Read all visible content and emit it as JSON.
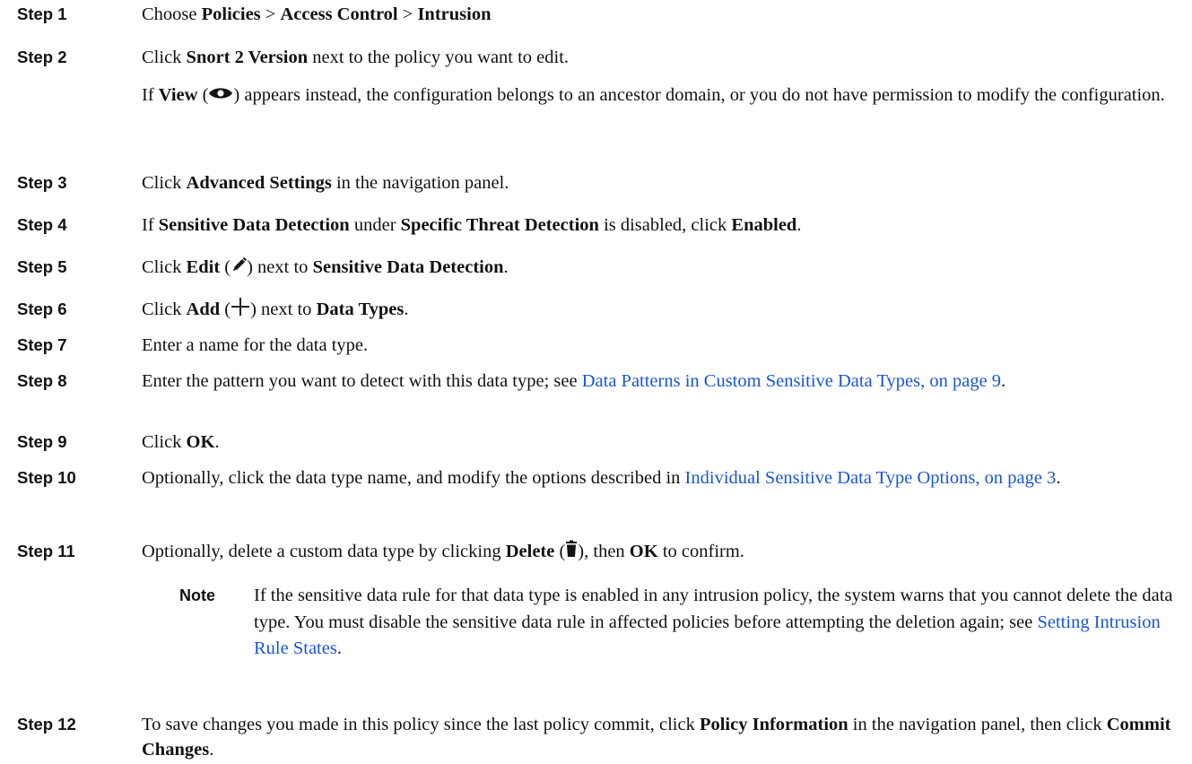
{
  "steps": [
    {
      "label": "Step 1",
      "t0": "Choose ",
      "b0": "Policies",
      "t1": " > ",
      "b1": "Access Control",
      "t2": " > ",
      "b2": "Intrusion"
    },
    {
      "label": "Step 2",
      "t0": "Click ",
      "b0": "Snort 2 Version",
      "t1": " next to the policy you want to edit.",
      "p2_t0": "If ",
      "p2_b0": "View",
      "p2_t1": " (",
      "p2_t2": ") appears instead, the configuration belongs to an ancestor domain, or you do not have permission to modify the configuration."
    },
    {
      "label": "Step 3",
      "t0": "Click ",
      "b0": "Advanced Settings",
      "t1": " in the navigation panel."
    },
    {
      "label": "Step 4",
      "t0": "If ",
      "b0": "Sensitive Data Detection",
      "t1": " under ",
      "b1": "Specific Threat Detection",
      "t2": " is disabled, click ",
      "b2": "Enabled",
      "t3": "."
    },
    {
      "label": "Step 5",
      "t0": "Click ",
      "b0": "Edit",
      "t1": " (",
      "t2": ") next to ",
      "b1": "Sensitive Data Detection",
      "t3": "."
    },
    {
      "label": "Step 6",
      "t0": "Click ",
      "b0": "Add",
      "t1": " (",
      "t2": ") next to ",
      "b1": "Data Types",
      "t3": "."
    },
    {
      "label": "Step 7",
      "t0": "Enter a name for the data type."
    },
    {
      "label": "Step 8",
      "t0": "Enter the pattern you want to detect with this data type; see ",
      "link": "Data Patterns in Custom Sensitive Data Types, on page 9",
      "t1": "."
    },
    {
      "label": "Step 9",
      "t0": "Click ",
      "b0": "OK",
      "t1": "."
    },
    {
      "label": "Step 10",
      "t0": "Optionally, click the data type name, and modify the options described in ",
      "link": "Individual Sensitive Data Type Options, on page 3",
      "t1": "."
    },
    {
      "label": "Step 11",
      "t0": "Optionally, delete a custom data type by clicking ",
      "b0": "Delete",
      "t1": " (",
      "t2": "), then ",
      "b1": "OK",
      "t3": " to confirm."
    },
    {
      "label": "Step 12",
      "t0": "To save changes you made in this policy since the last policy commit, click ",
      "b0": "Policy Information",
      "t1": " in the navigation panel, then click ",
      "b1": "Commit Changes",
      "t2": "."
    }
  ],
  "note": {
    "label": "Note",
    "t0": "If the sensitive data rule for that data type is enabled in any intrusion policy, the system warns that you cannot delete the data type. You must disable the sensitive data rule in affected policies before attempting the deletion again; see ",
    "link": "Setting Intrusion Rule States",
    "t1": "."
  },
  "icons": [
    "view-eye-icon",
    "edit-pencil-icon",
    "add-plus-icon",
    "delete-trash-icon"
  ],
  "colors": {
    "link": "#1a55d6",
    "text": "#111111"
  }
}
